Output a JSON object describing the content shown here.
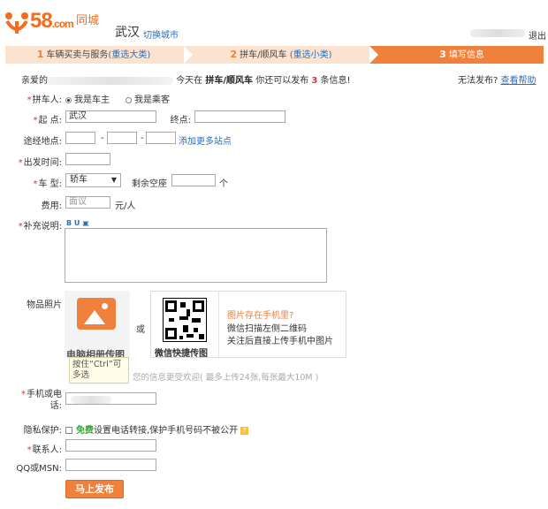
{
  "header": {
    "logo_text": "58",
    "logo_dot": ".com",
    "logo_sub": "同城",
    "city": "武汉",
    "switch_city": "切换城市",
    "logout": "退出"
  },
  "steps": [
    {
      "num": "1",
      "label": "车辆买卖与服务",
      "link": "(重选大类)"
    },
    {
      "num": "2",
      "label": "拼车/顺风车",
      "link": "(重选小类)"
    },
    {
      "num": "3",
      "label": "填写信息",
      "link": ""
    }
  ],
  "notice": {
    "prefix": "亲爱的",
    "mid": "今天在",
    "category": "拼车/顺风车",
    "mid2": "你还可以发布",
    "count": "3",
    "suffix": "条信息!",
    "cant_publish": "无法发布?",
    "help": "查看帮助"
  },
  "form": {
    "carpooler_label": "拼车人:",
    "role_owner": "我是车主",
    "role_passenger": "我是乘客",
    "origin_label": "起 点:",
    "origin_value": "武汉",
    "dest_label": "终点:",
    "via_label": "途经地点:",
    "via_dash": "-",
    "add_stops": "添加更多站点",
    "depart_label": "出发时间:",
    "car_type_label": "车 型:",
    "car_type_value": "轿车",
    "seats_label": "剩余空座",
    "seats_unit": "个",
    "fee_label": "费用:",
    "fee_placeholder": "面议",
    "fee_unit": "元/人",
    "notes_label": "补充说明:",
    "toolbar": "B U",
    "photos_label": "物品照片",
    "upload_photo": "电脑相册传图",
    "or": "或",
    "qr_caption": "微信快捷传图",
    "qr_line1": "图片存在手机里?",
    "qr_line2": "微信扫描左侧二维码",
    "qr_line3": "关注后直接上传手机中图片",
    "tooltip": "按住“Ctrl”可多选",
    "upload_hint": "您的信息更受欢迎( 最多上传24张,每张最大10M )",
    "phone_label": "手机或电话:",
    "privacy_label": "隐私保护:",
    "privacy_free": "免费",
    "privacy_text": "设置电话转接,保护手机号码不被公开",
    "contact_label": "联系人:",
    "qq_label": "QQ或MSN:",
    "submit": "马上发布"
  },
  "colors": {
    "brand_orange": "#f0813c",
    "link_blue": "#2f6db5",
    "required_red": "#e0322b"
  }
}
